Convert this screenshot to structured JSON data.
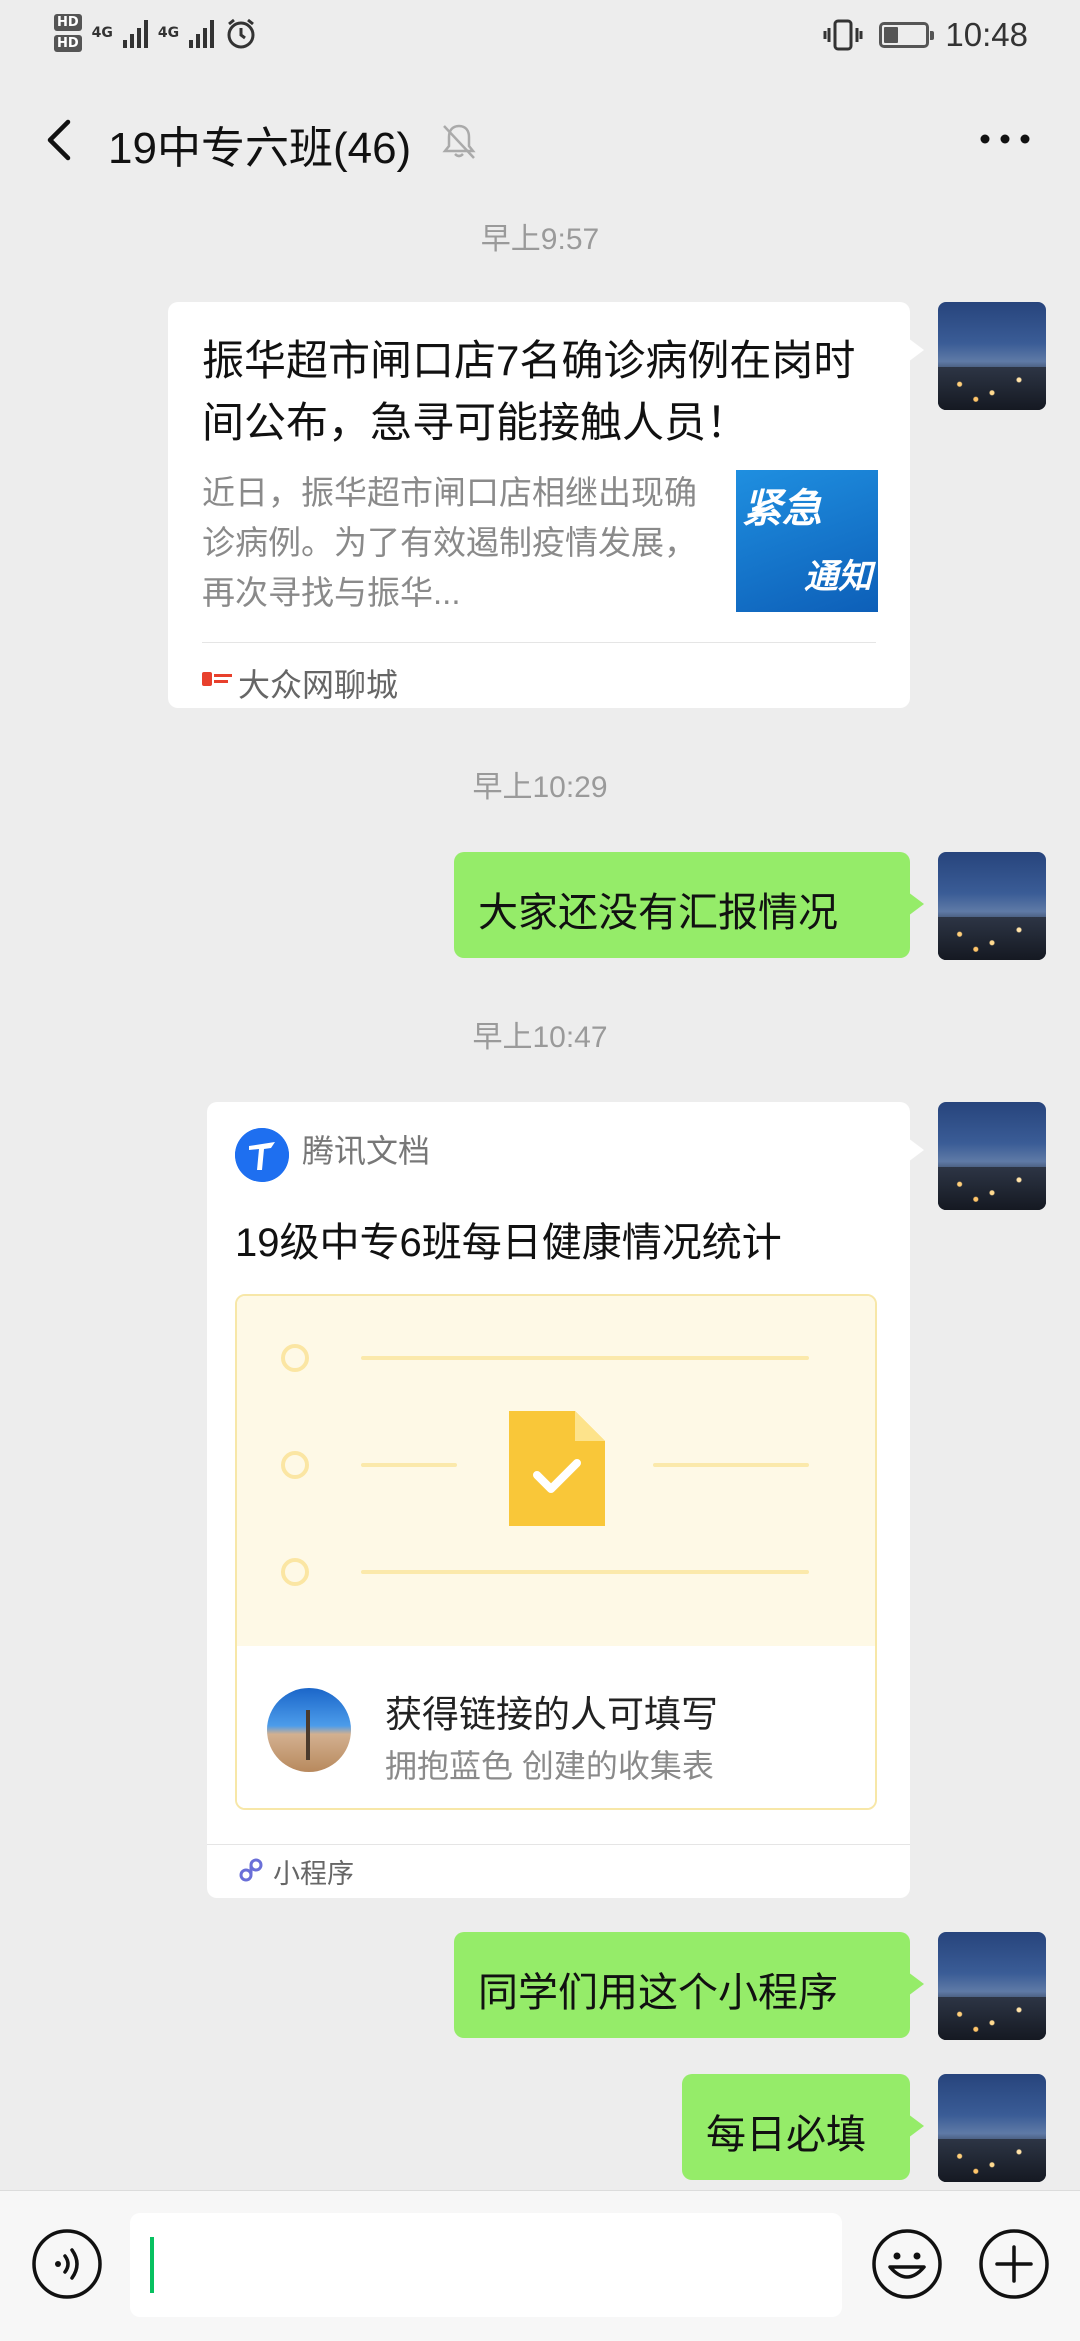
{
  "status_bar": {
    "badge": "HD",
    "network": "4G",
    "time": "10:48"
  },
  "nav": {
    "title": "19中专六班(46)"
  },
  "messages": {
    "ts1": "早上9:57",
    "article": {
      "title": "振华超市闸口店7名确诊病例在岗时间公布，急寻可能接触人员！",
      "description": "近日，振华超市闸口店相继出现确诊病例。为了有效遏制疫情发展，再次寻找与振华...",
      "thumb_text_1": "紧急",
      "thumb_text_2": "通知",
      "source": "大众网聊城"
    },
    "ts2": "早上10:29",
    "msg1": "大家还没有汇报情况",
    "ts3": "早上10:47",
    "miniprogram": {
      "app_name": "腾讯文档",
      "title": "19级中专6班每日健康情况统计",
      "fill_text": "获得链接的人可填写",
      "creator_text": "拥抱蓝色 创建的收集表",
      "footer": "小程序"
    },
    "msg2": "同学们用这个小程序",
    "msg3": "每日必填"
  }
}
